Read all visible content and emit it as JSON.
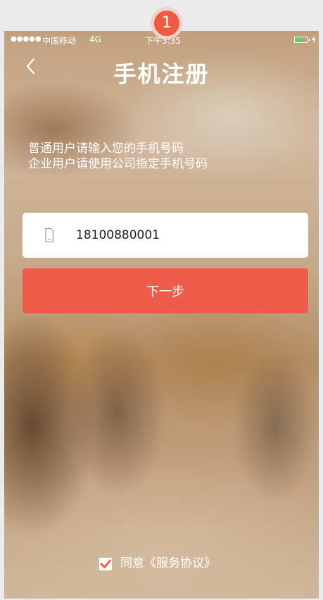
{
  "status_bar": {
    "signal": "●●●●●",
    "carrier": "中国移动",
    "network": "4G",
    "time": "下午3:35",
    "battery_level_fraction": 0.65
  },
  "step_badge": "1",
  "header": {
    "title": "手机注册",
    "back_icon": "chevron-left-icon"
  },
  "intro": {
    "line1": "普通用户请输入您的手机号码",
    "line2": "企业用户请使用公司指定手机号码"
  },
  "phone_field": {
    "value": "18100880001",
    "icon": "phone-icon"
  },
  "next_button": {
    "label": "下一步",
    "color": "#f05c4c"
  },
  "agreement": {
    "checked": true,
    "label": "同意《服务协议》",
    "check_color": "#f05c4c"
  }
}
